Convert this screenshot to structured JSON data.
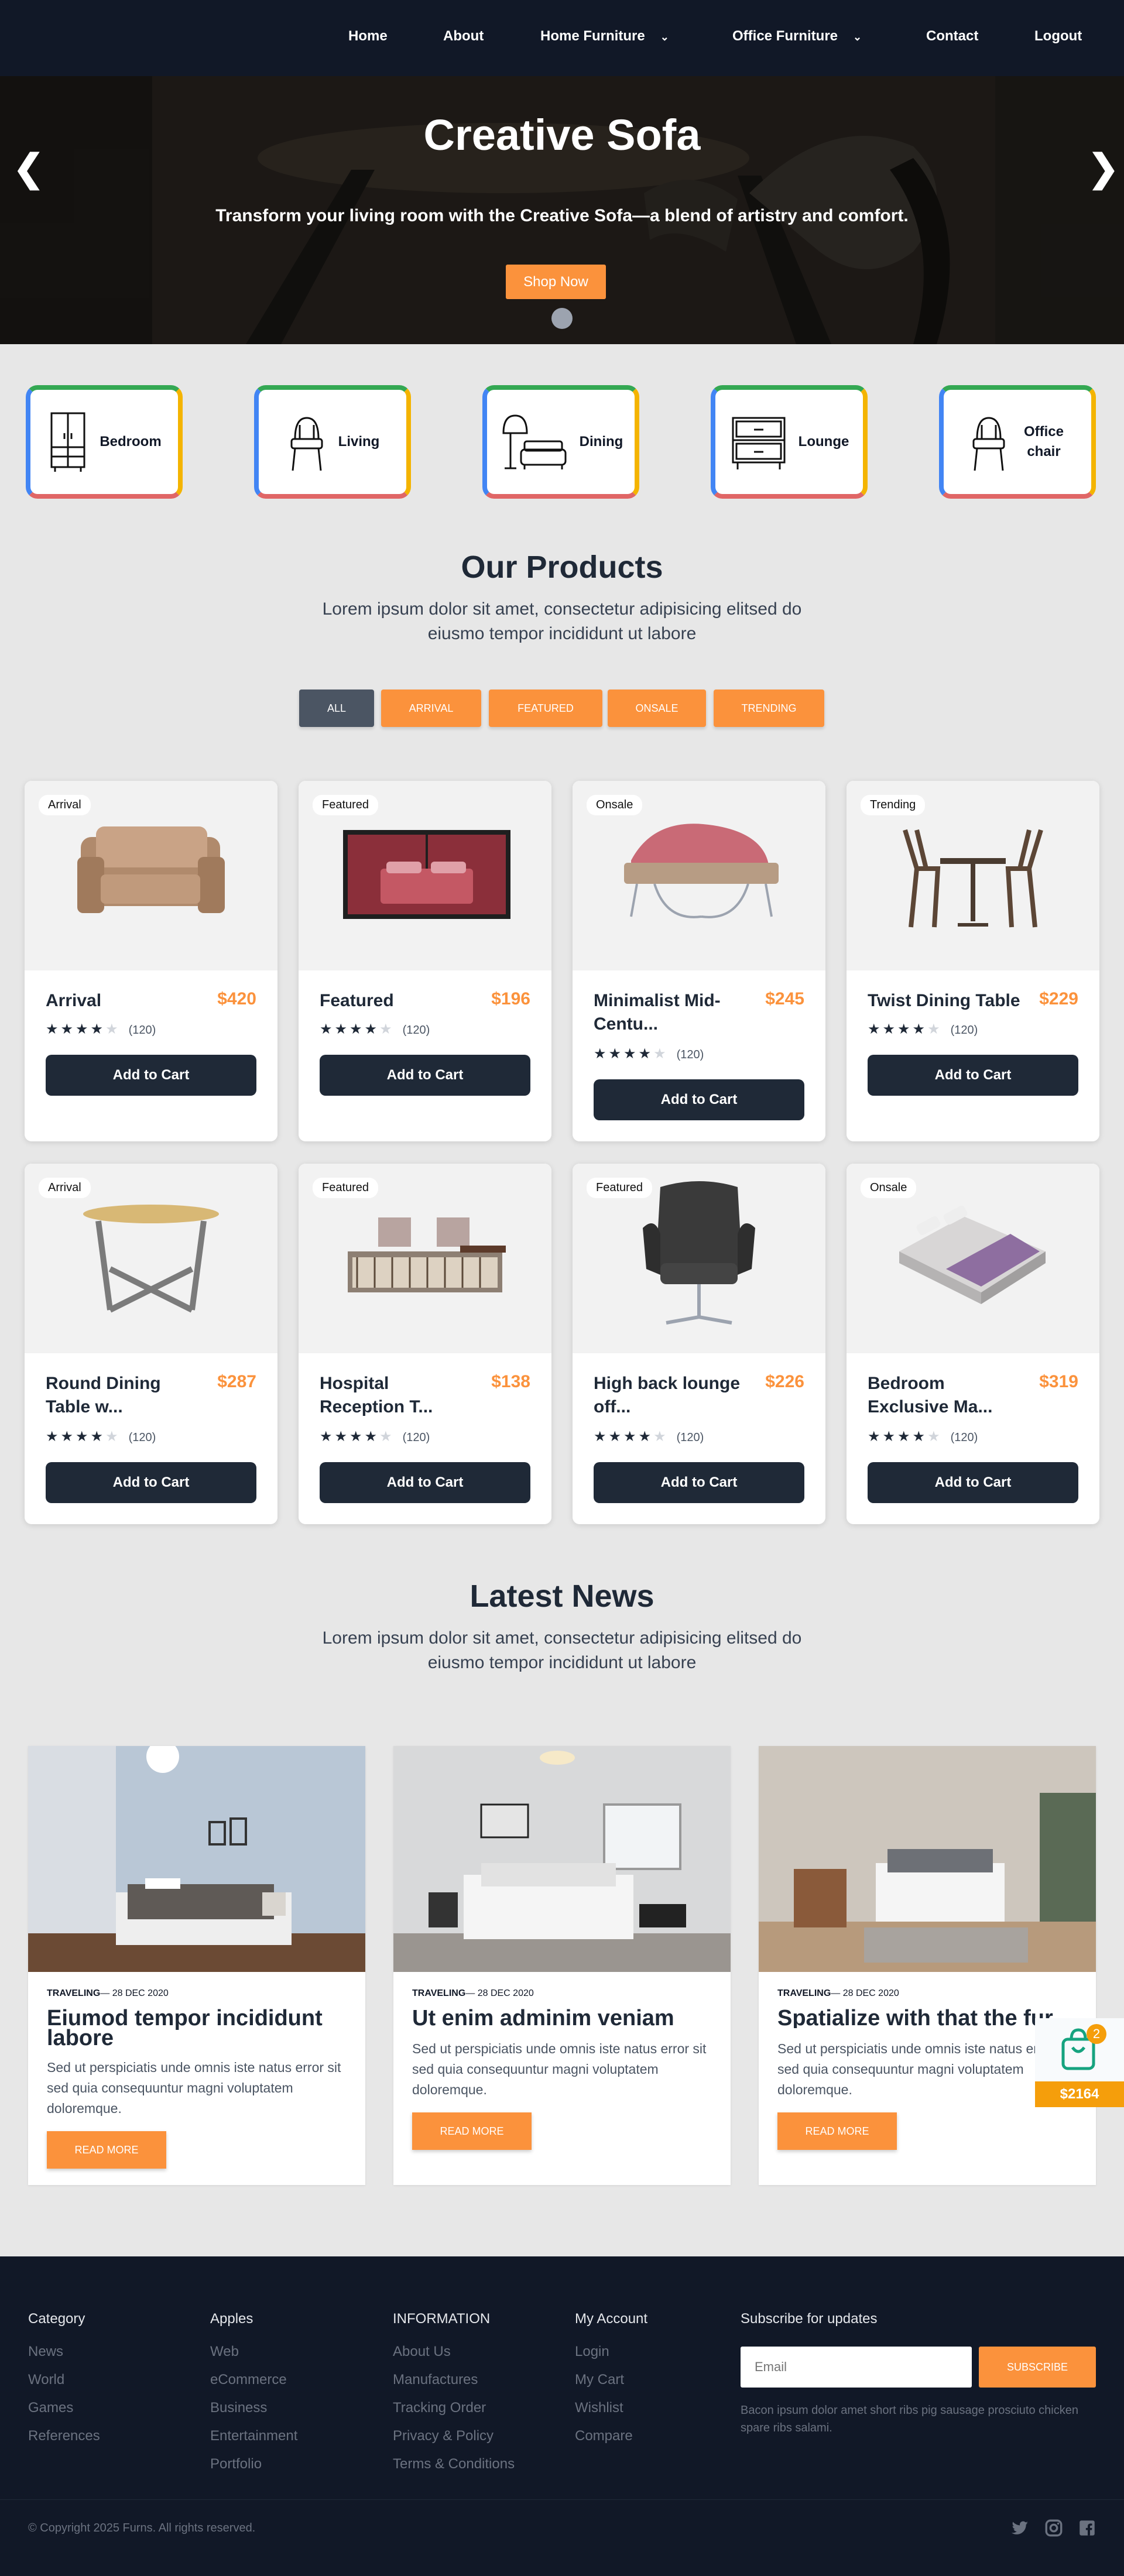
{
  "nav": {
    "items": [
      "Home",
      "About",
      "Home Furniture",
      "Office Furniture",
      "Contact",
      "Logout"
    ]
  },
  "hero": {
    "title": "Creative Sofa",
    "subtitle": "Transform your living room with the Creative Sofa—a blend of artistry and comfort.",
    "button": "Shop Now",
    "prev": "❮",
    "next": "❯"
  },
  "categories": [
    {
      "label": "Bedroom",
      "icon": "wardrobe-icon"
    },
    {
      "label": "Living",
      "icon": "chair-icon"
    },
    {
      "label": "Dining",
      "icon": "lamp-sofa-icon"
    },
    {
      "label": "Lounge",
      "icon": "drawer-cabinet-icon"
    },
    {
      "label": "Office chair",
      "icon": "chair-icon"
    }
  ],
  "products_section": {
    "title": "Our Products",
    "description": "Lorem ipsum dolor sit amet, consectetur adipisicing elitsed do eiusmo tempor incididunt ut labore",
    "filters": [
      "ALL",
      "ARRIVAL",
      "FEATURED",
      "ONSALE",
      "TRENDING"
    ],
    "active_filter": "ALL",
    "add_to_cart": "Add to Cart",
    "products": [
      {
        "badge": "Arrival",
        "name": "Arrival",
        "price": "$420",
        "rating": 4,
        "reviews": "(120)"
      },
      {
        "badge": "Featured",
        "name": "Featured",
        "price": "$196",
        "rating": 4,
        "reviews": "(120)"
      },
      {
        "badge": "Onsale",
        "name": "Minimalist Mid-Centu...",
        "price": "$245",
        "rating": 4,
        "reviews": "(120)"
      },
      {
        "badge": "Trending",
        "name": "Twist Dining Table",
        "price": "$229",
        "rating": 4,
        "reviews": "(120)"
      },
      {
        "badge": "Arrival",
        "name": "Round Dining Table w...",
        "price": "$287",
        "rating": 4,
        "reviews": "(120)"
      },
      {
        "badge": "Featured",
        "name": "Hospital Reception T...",
        "price": "$138",
        "rating": 4,
        "reviews": "(120)"
      },
      {
        "badge": "Featured",
        "name": "High back lounge off...",
        "price": "$226",
        "rating": 4,
        "reviews": "(120)"
      },
      {
        "badge": "Onsale",
        "name": "Bedroom Exclusive Ma...",
        "price": "$319",
        "rating": 4,
        "reviews": "(120)"
      }
    ]
  },
  "news_section": {
    "title": "Latest News",
    "description": "Lorem ipsum dolor sit amet, consectetur adipisicing elitsed do eiusmo tempor incididunt ut labore",
    "read_more": "READ MORE",
    "posts": [
      {
        "category": "TRAVELING",
        "date": "— 28 DEC 2020",
        "title": "Eiumod tempor incididunt labore",
        "text": "Sed ut perspiciatis unde omnis iste natus error sit sed quia consequuntur magni voluptatem doloremque."
      },
      {
        "category": "TRAVELING",
        "date": "— 28 DEC 2020",
        "title": "Ut enim adminim veniam",
        "text": "Sed ut perspiciatis unde omnis iste natus error sit sed quia consequuntur magni voluptatem doloremque."
      },
      {
        "category": "TRAVELING",
        "date": "— 28 DEC 2020",
        "title": "Spatialize with that the fur",
        "text": "Sed ut perspiciatis unde omnis iste natus error sit sed quia consequuntur magni voluptatem doloremque."
      }
    ]
  },
  "floating_cart": {
    "count": "2",
    "total": "$2164"
  },
  "footer": {
    "columns": [
      {
        "heading": "Category",
        "links": [
          "News",
          "World",
          "Games",
          "References"
        ]
      },
      {
        "heading": "Apples",
        "links": [
          "Web",
          "eCommerce",
          "Business",
          "Entertainment",
          "Portfolio"
        ]
      },
      {
        "heading": "INFORMATION",
        "links": [
          "About Us",
          "Manufactures",
          "Tracking Order",
          "Privacy & Policy",
          "Terms & Conditions"
        ]
      },
      {
        "heading": "My Account",
        "links": [
          "Login",
          "My Cart",
          "Wishlist",
          "Compare"
        ]
      }
    ],
    "subscribe": {
      "heading": "Subscribe for updates",
      "placeholder": "Email",
      "button": "SUBSCRIBE",
      "description": "Bacon ipsum dolor amet short ribs pig sausage prosciuto chicken spare ribs salami."
    },
    "copyright": "© Copyright 2025 Furns. All rights reserved.",
    "social": [
      "twitter-icon",
      "instagram-icon",
      "facebook-icon"
    ]
  },
  "colors": {
    "nav_bg": "#111827",
    "accent": "#fb923c",
    "button_dark": "#1f2937",
    "active_filter": "#4b5563"
  }
}
